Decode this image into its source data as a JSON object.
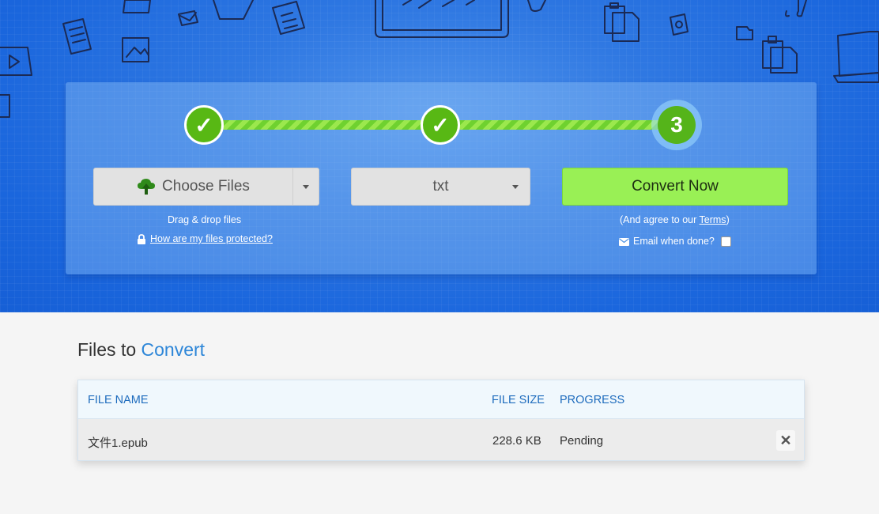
{
  "steps": [
    {
      "label": "✓",
      "state": "done"
    },
    {
      "label": "✓",
      "state": "done"
    },
    {
      "label": "3",
      "state": "active"
    }
  ],
  "choose_files": {
    "label": "Choose Files",
    "icon": "cloud-upload-icon",
    "drag_text": "Drag & drop files",
    "protection_link": "How are my files protected?"
  },
  "format": {
    "selected": "txt"
  },
  "convert": {
    "label": "Convert Now",
    "agree_prefix": "(And agree to our ",
    "terms_link": "Terms",
    "agree_suffix": ")",
    "email_label": "Email when done?"
  },
  "files_section": {
    "title_prefix": "Files to",
    "title_accent": "Convert",
    "columns": [
      "FILE NAME",
      "FILE SIZE",
      "PROGRESS"
    ],
    "rows": [
      {
        "name": "文件1.epub",
        "size": "228.6 KB",
        "progress": "Pending"
      }
    ],
    "remove_glyph": "✕"
  },
  "colors": {
    "hero_blue": "#1a66dd",
    "step_green": "#58b814",
    "convert_green": "#99f055",
    "accent_blue": "#2d86d8"
  }
}
